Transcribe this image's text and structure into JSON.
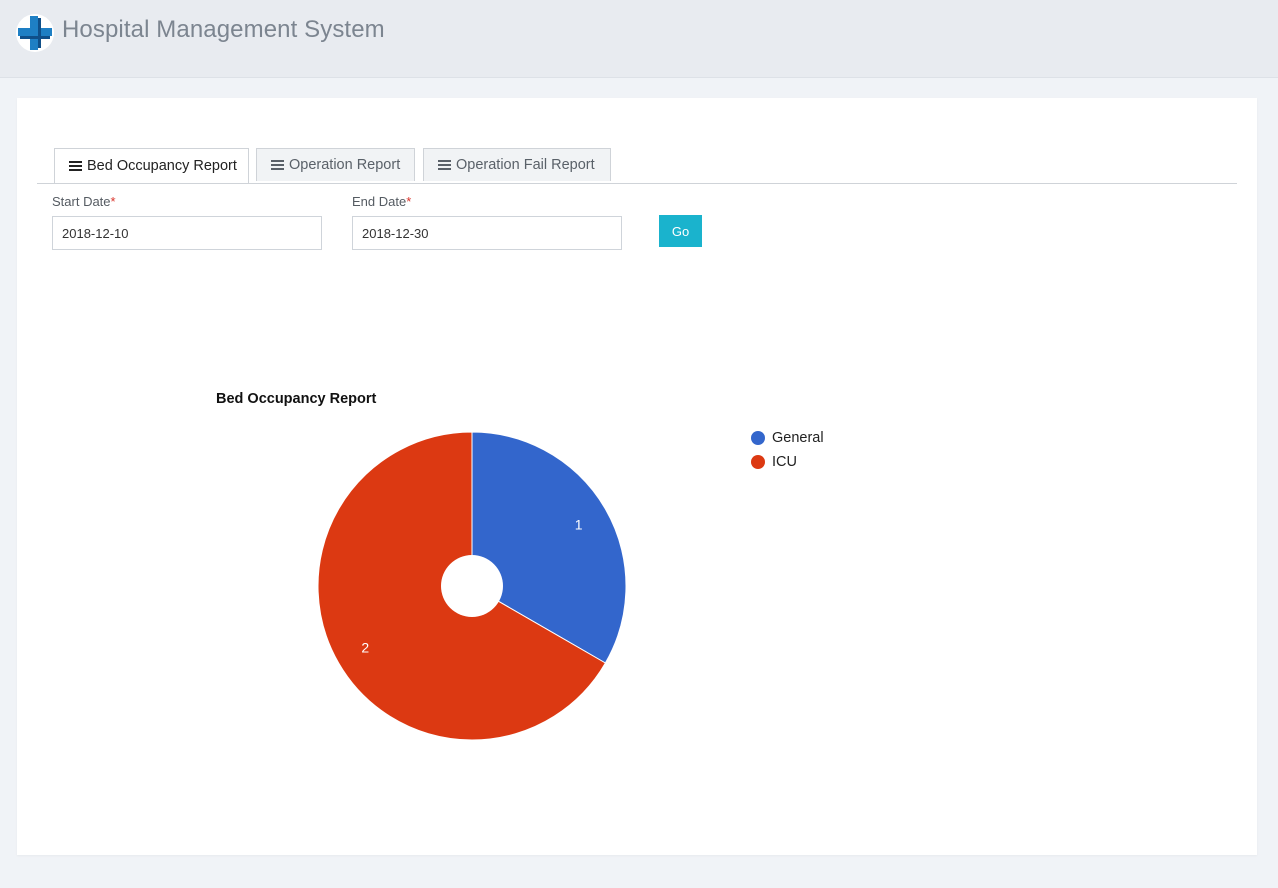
{
  "header": {
    "title": "Hospital Management System",
    "logo_icon": "hospital-cross-icon"
  },
  "tabs": [
    {
      "label": "Bed Occupancy Report",
      "icon": "menu-lines-icon",
      "active": true
    },
    {
      "label": "Operation Report",
      "icon": "menu-lines-icon",
      "active": false
    },
    {
      "label": "Operation Fail Report",
      "icon": "menu-lines-icon",
      "active": false
    }
  ],
  "form": {
    "start_label": "Start Date",
    "start_value": "2018-12-10",
    "end_label": "End Date",
    "end_value": "2018-12-30",
    "required_mark": "*",
    "go_label": "Go"
  },
  "colors": {
    "accent": "#1ab3cd",
    "general": "#3366cc",
    "icu": "#dc3912",
    "required": "#d9342b"
  },
  "chart_data": {
    "type": "pie",
    "title": "Bed Occupancy Report",
    "categories": [
      "General",
      "ICU"
    ],
    "values": [
      1,
      2
    ],
    "colors": [
      "#3366cc",
      "#dc3912"
    ],
    "data_labels": [
      "1",
      "2"
    ],
    "donut": true,
    "legend_position": "right"
  }
}
